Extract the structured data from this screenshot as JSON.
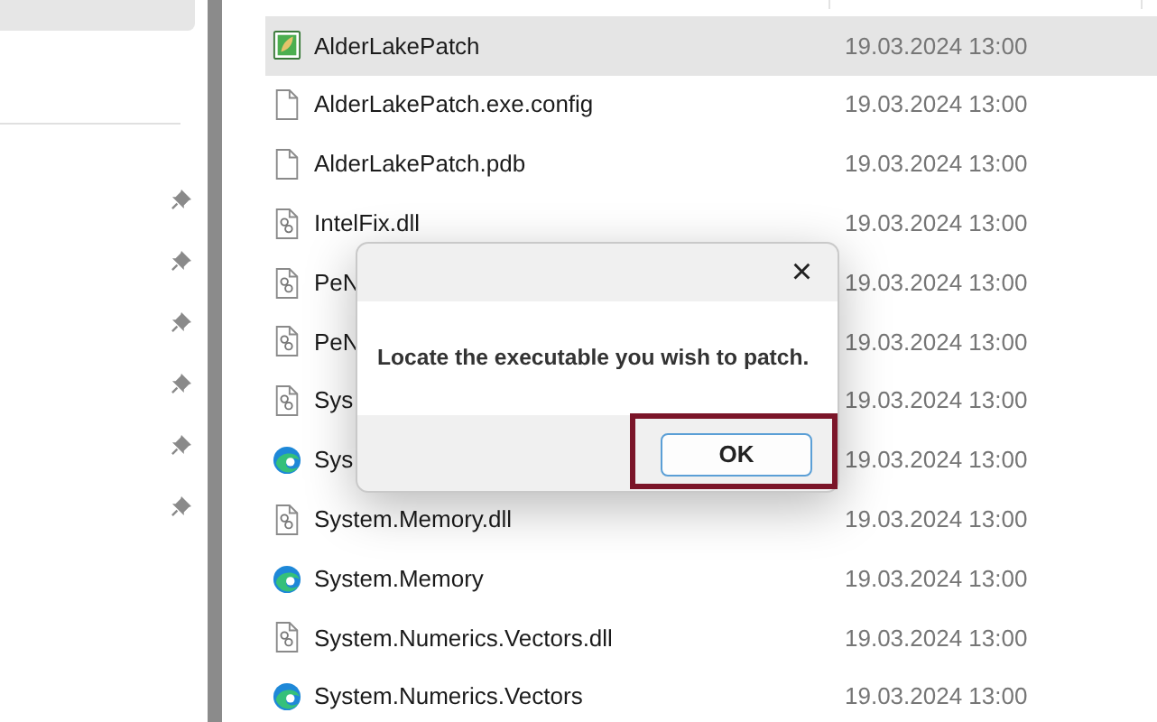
{
  "sidebar": {
    "top_item": {
      "selected": true
    },
    "quick_access": [
      {
        "pinned": true
      },
      {
        "pinned": true
      },
      {
        "pinned": true
      },
      {
        "pinned": true
      },
      {
        "pinned": true
      },
      {
        "pinned": true
      }
    ]
  },
  "files": [
    {
      "name": "AlderLakePatch",
      "kind": "app",
      "date": "19.03.2024 13:00",
      "selected": true
    },
    {
      "name": "AlderLakePatch.exe.config",
      "kind": "file",
      "date": "19.03.2024 13:00",
      "selected": false
    },
    {
      "name": "AlderLakePatch.pdb",
      "kind": "file",
      "date": "19.03.2024 13:00",
      "selected": false
    },
    {
      "name": "IntelFix.dll",
      "kind": "dll",
      "date": "19.03.2024 13:00",
      "selected": false
    },
    {
      "name": "PeN",
      "kind": "dll",
      "date": "19.03.2024 13:00",
      "selected": false
    },
    {
      "name": "PeN",
      "kind": "dll",
      "date": "19.03.2024 13:00",
      "selected": false
    },
    {
      "name": "Sys",
      "kind": "dll",
      "date": "19.03.2024 13:00",
      "selected": false
    },
    {
      "name": "Sys",
      "kind": "swirl",
      "date": "19.03.2024 13:00",
      "selected": false
    },
    {
      "name": "System.Memory.dll",
      "kind": "dll",
      "date": "19.03.2024 13:00",
      "selected": false
    },
    {
      "name": "System.Memory",
      "kind": "swirl",
      "date": "19.03.2024 13:00",
      "selected": false
    },
    {
      "name": "System.Numerics.Vectors.dll",
      "kind": "dll",
      "date": "19.03.2024 13:00",
      "selected": false
    },
    {
      "name": "System.Numerics.Vectors",
      "kind": "swirl",
      "date": "19.03.2024 13:00",
      "selected": false
    }
  ],
  "dialog": {
    "close": "×",
    "message": "Locate the executable you wish to patch.",
    "button": "OK",
    "button_highlighted": true
  }
}
